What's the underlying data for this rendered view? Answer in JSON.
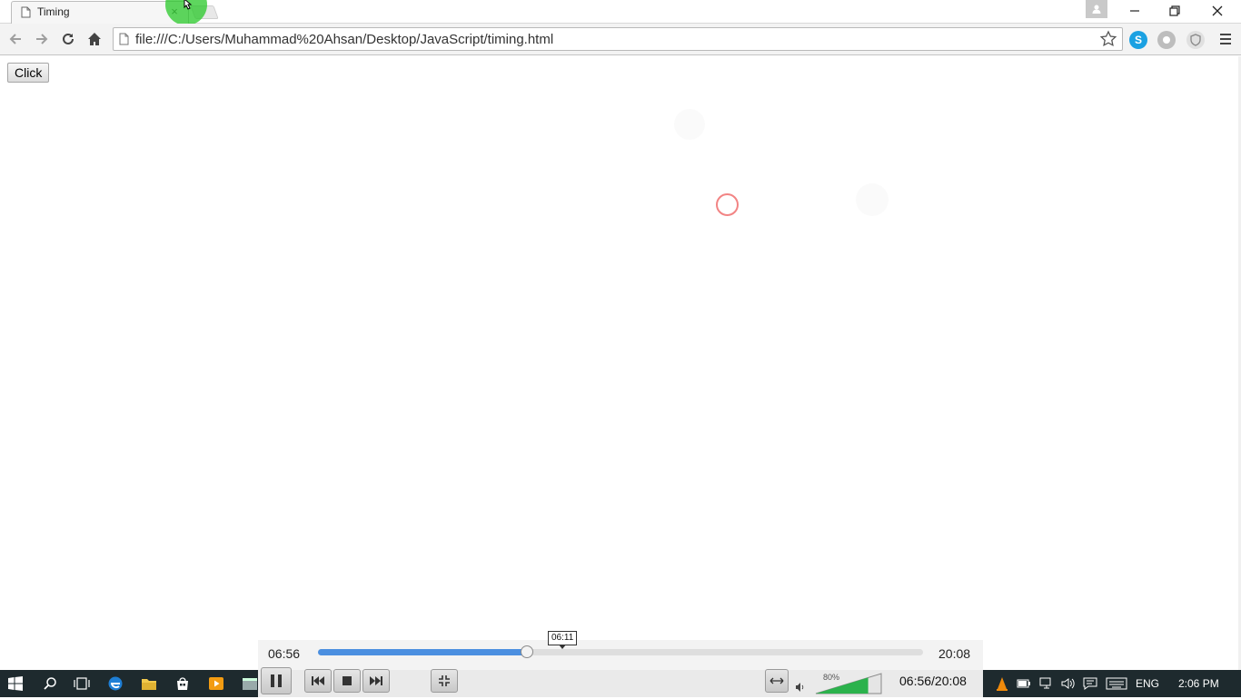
{
  "browser": {
    "tab": {
      "title": "Timing"
    },
    "address_bar": {
      "url": "file:///C:/Users/Muhammad%20Ahsan/Desktop/JavaScript/timing.html"
    },
    "extension_icons": [
      "skype-icon",
      "ghost-extension-icon",
      "shield-extension-icon"
    ],
    "window_controls": [
      "minimize-icon",
      "restore-icon",
      "close-icon"
    ]
  },
  "page": {
    "click_button_label": "Click"
  },
  "player": {
    "current_time": "06:56",
    "total_time": "20:08",
    "hover_tooltip": "06:11",
    "progress_fraction": 0.345,
    "volume_label": "80%",
    "volume_fraction": 0.8,
    "clock_readout": "06:56/20:08",
    "accent_color": "#4b8fe0"
  },
  "taskbar": {
    "language": "ENG",
    "time": "2:06 PM"
  }
}
